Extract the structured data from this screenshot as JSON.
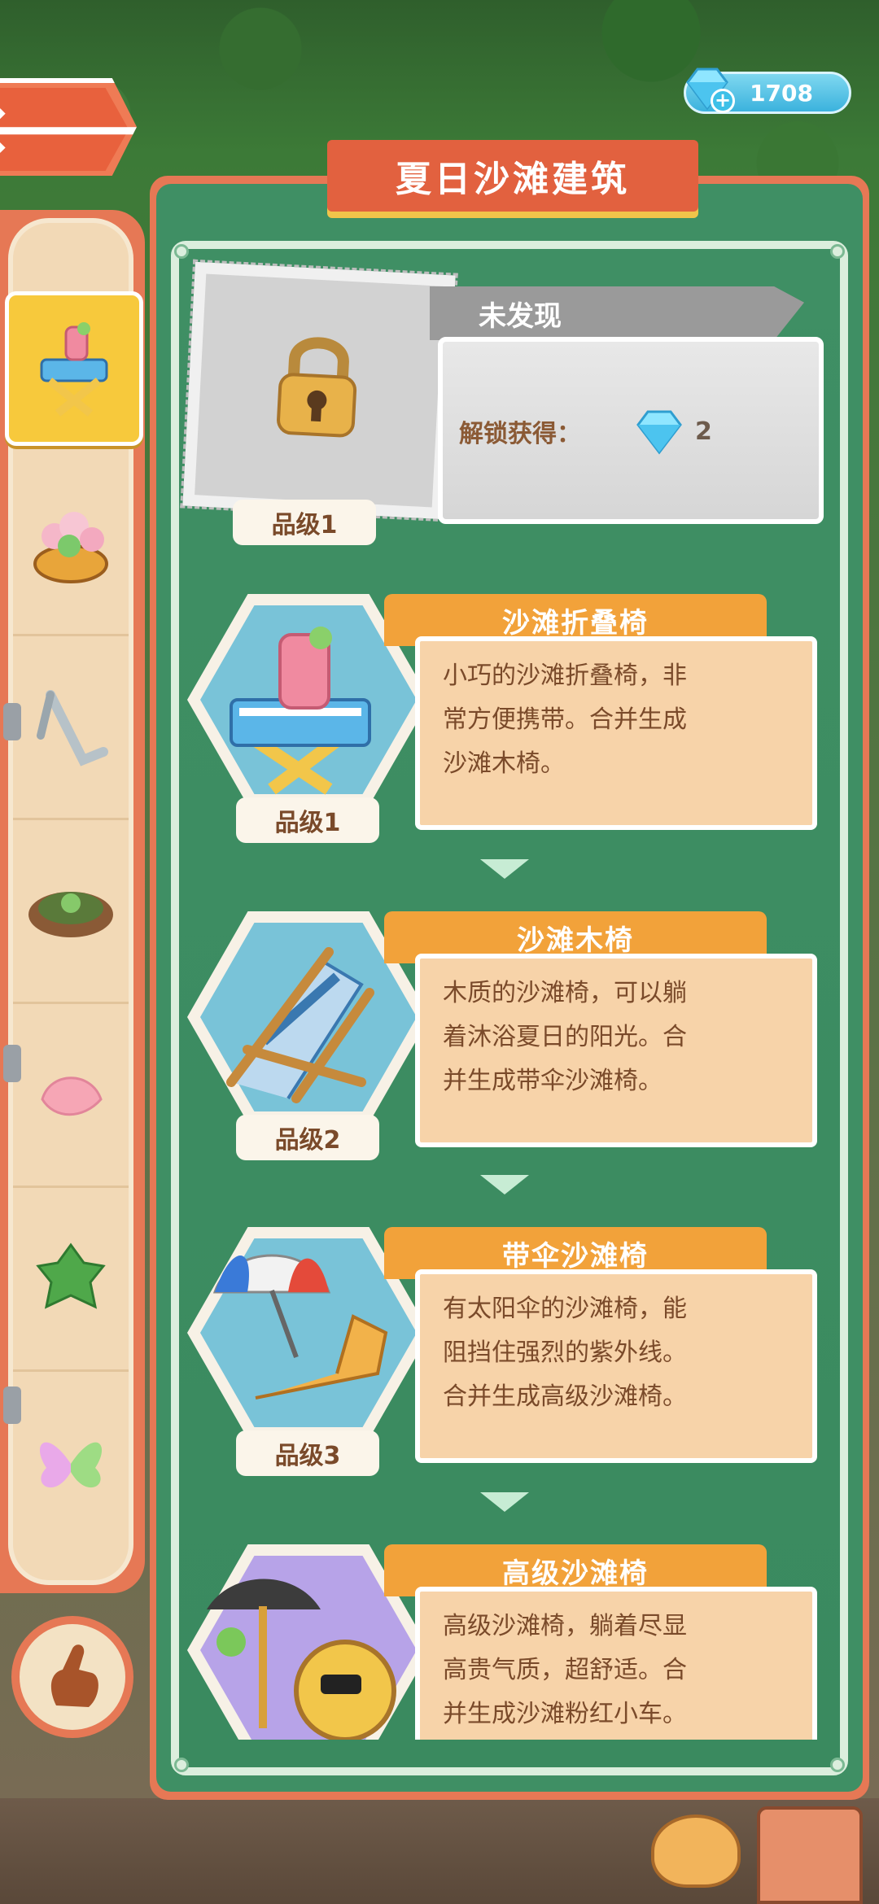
{
  "header": {
    "title": "夏日沙滩建筑",
    "gems": "1708"
  },
  "locked_entry": {
    "status": "未发现",
    "reward_label": "解锁获得：",
    "reward_count": "2",
    "level": "品级1"
  },
  "entries": [
    {
      "name": "沙滩折叠椅",
      "level": "品级1",
      "desc_lines": [
        "小巧的沙滩折叠椅，非",
        "常方便携带。合并生成",
        "沙滩木椅。"
      ]
    },
    {
      "name": "沙滩木椅",
      "level": "品级2",
      "desc_lines": [
        "木质的沙滩椅，可以躺",
        "着沐浴夏日的阳光。合",
        "并生成带伞沙滩椅。"
      ]
    },
    {
      "name": "带伞沙滩椅",
      "level": "品级3",
      "desc_lines": [
        "有太阳伞的沙滩椅，能",
        "阻挡住强烈的紫外线。",
        "合并生成高级沙滩椅。"
      ]
    },
    {
      "name": "高级沙滩椅",
      "desc_lines": [
        "高级沙滩椅，躺着尽显",
        "高贵气质，超舒适。合",
        "并生成沙滩粉红小车。"
      ]
    }
  ],
  "sidebar": {
    "items": [
      "beach-chair-icon",
      "flower-basket-icon",
      "tool-icon",
      "stump-icon",
      "petal-icon",
      "leaf-icon",
      "butterfly-icon"
    ]
  },
  "colors": {
    "accent": "#e67855",
    "panel": "#3f8f64",
    "tab": "#f2a23a",
    "card": "#f7d3a9"
  }
}
